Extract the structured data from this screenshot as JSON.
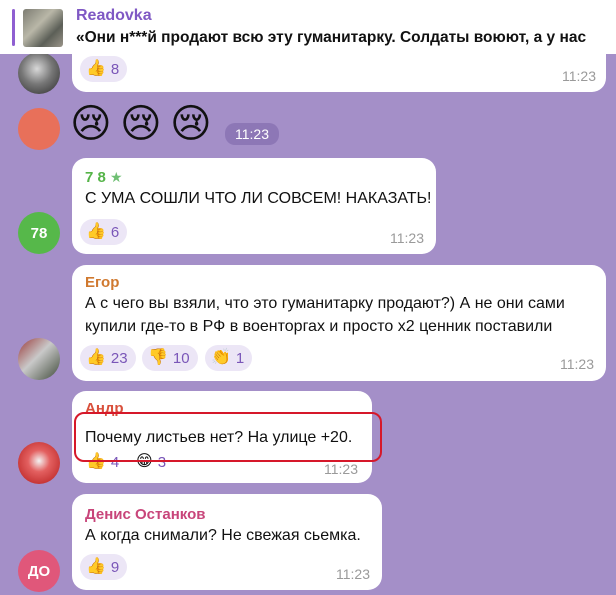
{
  "pinned": {
    "channel": "Readovka",
    "text": "«Они н***й продают всю эту гуманитарку. Солдаты воюют, а у нас"
  },
  "messages": [
    {
      "id": "m0",
      "reactions": [
        {
          "icon": "👍",
          "count": "8"
        }
      ],
      "time": "11:23"
    },
    {
      "id": "m1",
      "emojis": [
        "😢",
        "😢",
        "😢"
      ],
      "time": "11:23"
    },
    {
      "id": "m2",
      "sender": "7 8",
      "sender_color": "#55b448",
      "avatar_text": "78",
      "avatar_color": "#56b84a",
      "text": "С УМА СОШЛИ ЧТО ЛИ СОВСЕМ! НАКАЗАТЬ!",
      "reactions": [
        {
          "icon": "👍",
          "count": "6"
        }
      ],
      "time": "11:23"
    },
    {
      "id": "m3",
      "sender": "Егор",
      "sender_color": "#d0792f",
      "text_lines": [
        "А с чего вы взяли, что это гуманитарку продают?) А не они сами",
        "купили где-то в РФ в военторгах и просто х2 ценник поставили"
      ],
      "reactions": [
        {
          "icon": "👍",
          "count": "23"
        },
        {
          "icon": "👎",
          "count": "10"
        },
        {
          "icon": "👏",
          "count": "1"
        }
      ],
      "time": "11:23"
    },
    {
      "id": "m4",
      "sender": "Андр",
      "sender_color": "#d9503c",
      "text": "Почему листьев нет? На улице +20.",
      "reactions": [
        {
          "icon": "👍",
          "count": "4"
        },
        {
          "icon": "😁",
          "count": "3"
        }
      ],
      "time": "11:23"
    },
    {
      "id": "m5",
      "sender": "Денис Останков",
      "sender_color": "#c8457a",
      "avatar_text": "ДО",
      "avatar_color": "#e0577a",
      "text": "А когда снимали? Не свежая сьемка.",
      "reactions": [
        {
          "icon": "👍",
          "count": "9"
        }
      ],
      "time": "11:23"
    }
  ]
}
